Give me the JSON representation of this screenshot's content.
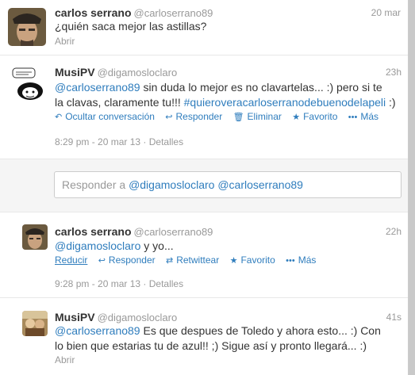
{
  "tweet1": {
    "name": "carlos serrano",
    "handle": "@carloserrano89",
    "time": "20 mar",
    "text": "¿quién saca mejor las astillas?",
    "open": "Abrir"
  },
  "tweet2": {
    "name": "MusiPV",
    "handle": "@digamosloclaro",
    "time": "23h",
    "mention": "@carloserrano89",
    "text_a": " sin duda lo mejor es no clavartelas... :) pero si te",
    "text_b": "la clavas, claramente tu!!! ",
    "hashtag": "#quieroveracarloserranodebuenodelapeli",
    "text_c": " :)",
    "actions": {
      "hide": "Ocultar conversación",
      "reply": "Responder",
      "delete": "Eliminar",
      "favorite": "Favorito",
      "more": "Más"
    },
    "timestamp": "8:29 pm - 20 mar 13",
    "details": "Detalles"
  },
  "reply_box": {
    "prefix": "Responder a ",
    "mention1": "@digamosloclaro",
    "mention2": "@carloserrano89"
  },
  "tweet3": {
    "name": "carlos serrano",
    "handle": "@carloserrano89",
    "time": "22h",
    "mention": "@digamosloclaro",
    "text": " y yo...",
    "actions": {
      "collapse": "Reducir",
      "reply": "Responder",
      "retweet": "Retwittear",
      "favorite": "Favorito",
      "more": "Más"
    },
    "timestamp": "9:28 pm - 20 mar 13",
    "details": "Detalles"
  },
  "tweet4": {
    "name": "MusiPV",
    "handle": "@digamosloclaro",
    "time": "41s",
    "mention": "@carloserrano89",
    "text_a": " Es que despues de Toledo y ahora esto... :) Con",
    "text_b": "lo bien que estarias tu de azul!! ;) Sigue así y pronto llegará... :)",
    "open": "Abrir"
  },
  "icons": {
    "hide": "↶",
    "reply": "↩",
    "delete": "🗑",
    "favorite": "★",
    "retweet": "⇄",
    "more": "•••"
  },
  "colors": {
    "link": "#2f7dbd",
    "muted": "#999999"
  }
}
